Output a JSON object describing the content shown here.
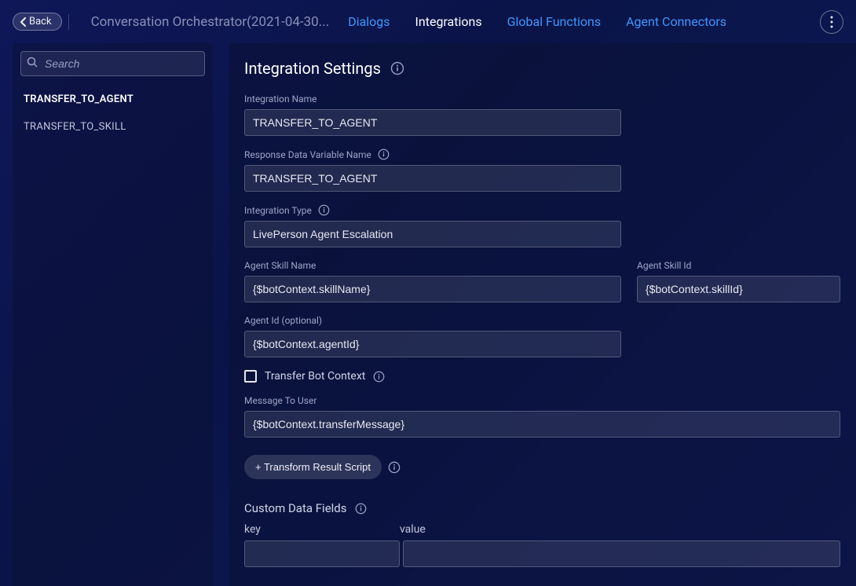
{
  "header": {
    "back_label": "Back",
    "title": "Conversation Orchestrator(2021-04-30...",
    "tabs": [
      {
        "label": "Dialogs",
        "active": false
      },
      {
        "label": "Integrations",
        "active": true
      },
      {
        "label": "Global Functions",
        "active": false
      },
      {
        "label": "Agent Connectors",
        "active": false
      }
    ]
  },
  "sidebar": {
    "search_placeholder": "Search",
    "items": [
      {
        "label": "TRANSFER_TO_AGENT",
        "active": true
      },
      {
        "label": "TRANSFER_TO_SKILL",
        "active": false
      }
    ]
  },
  "page": {
    "title": "Integration Settings"
  },
  "form": {
    "integration_name": {
      "label": "Integration Name",
      "value": "TRANSFER_TO_AGENT"
    },
    "response_var": {
      "label": "Response Data Variable Name",
      "value": "TRANSFER_TO_AGENT"
    },
    "integration_type": {
      "label": "Integration Type",
      "value": "LivePerson Agent Escalation"
    },
    "agent_skill_name": {
      "label": "Agent Skill Name",
      "value": "{$botContext.skillName}"
    },
    "agent_skill_id": {
      "label": "Agent Skill Id",
      "value": "{$botContext.skillId}"
    },
    "agent_id": {
      "label": "Agent Id (optional)",
      "value": "{$botContext.agentId}"
    },
    "transfer_context": {
      "label": "Transfer Bot Context",
      "checked": false
    },
    "message_to_user": {
      "label": "Message To User",
      "value": "{$botContext.transferMessage}"
    },
    "transform_btn": "+ Transform Result Script",
    "custom_fields": {
      "label": "Custom Data Fields",
      "key_header": "key",
      "value_header": "value",
      "rows": [
        {
          "key": "",
          "value": ""
        }
      ]
    }
  }
}
